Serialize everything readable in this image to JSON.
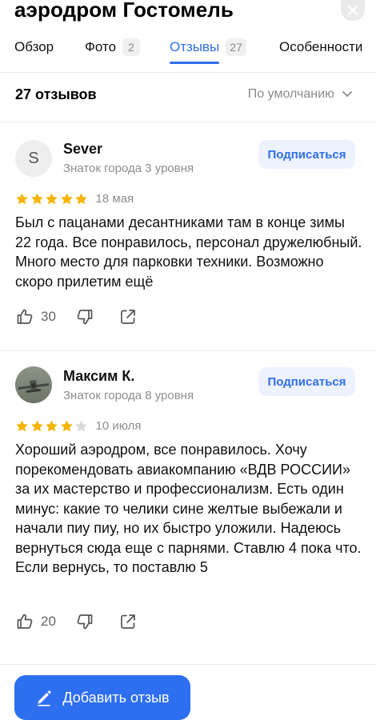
{
  "place": {
    "title": "аэродром Гостомель"
  },
  "tabs": [
    {
      "label": "Обзор",
      "count": ""
    },
    {
      "label": "Фото",
      "count": "2"
    },
    {
      "label": "Отзывы",
      "count": "27"
    },
    {
      "label": "Особенности",
      "count": ""
    }
  ],
  "reviews_header": {
    "count_label": "27 отзывов",
    "sort_label": "По умолчанию"
  },
  "reviews": [
    {
      "avatar_letter": "S",
      "author": "Sever",
      "level": "Знаток города 3 уровня",
      "subscribe": "Подписаться",
      "rating": 5,
      "date": "18 мая",
      "text": "Был с пацанами десантниками  там в конце зимы 22 года. Все понравилось, персонал дружелюбный. Много место для парковки техники. Возможно скоро прилетим ещё",
      "likes": "30"
    },
    {
      "avatar_letter": "",
      "author": "Максим К.",
      "level": "Знаток города 8 уровня",
      "subscribe": "Подписаться",
      "rating": 4,
      "date": "10 июля",
      "text": "Хороший аэродром, все понравилось. Хочу порекомендовать авиакомпанию «ВДВ РОССИИ» за их мастерство и профессионализм. Есть один минус: какие то челики сине желтые выбежали и начали пиу пиу, но их быстро уложили. Надеюсь вернуться сюда еще с парнями. Ставлю 4 пока что. Если вернусь, то поставлю 5",
      "likes": "20"
    }
  ],
  "bottom": {
    "add_review_label": "Добавить отзыв"
  },
  "colors": {
    "accent": "#2f6fe8",
    "star": "#f5b400",
    "star_empty": "#d9d9d9"
  }
}
